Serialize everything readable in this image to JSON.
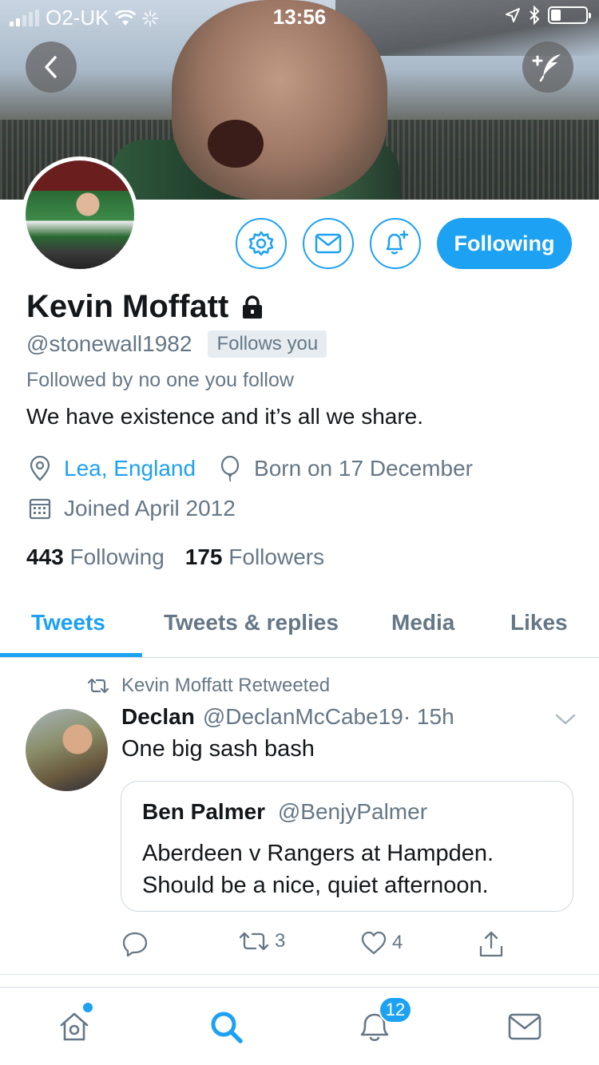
{
  "status_bar": {
    "carrier": "O2-UK",
    "time": "13:56"
  },
  "profile": {
    "name": "Kevin Moffatt",
    "handle": "@stonewall1982",
    "follows_you_label": "Follows you",
    "followed_by": "Followed by no one you follow",
    "bio": "We have existence and it’s all we share.",
    "location": "Lea, England",
    "birthday": "Born on 17 December",
    "joined": "Joined April 2012",
    "following_count": "443",
    "following_label": "Following",
    "followers_count": "175",
    "followers_label": "Followers",
    "follow_button_label": "Following",
    "locked": true
  },
  "tabs": [
    {
      "label": "Tweets",
      "active": true
    },
    {
      "label": "Tweets & replies",
      "active": false
    },
    {
      "label": "Media",
      "active": false
    },
    {
      "label": "Likes",
      "active": false
    }
  ],
  "tweet": {
    "retweeted_by": "Kevin Moffatt Retweeted",
    "author_name": "Declan",
    "author_handle": "@DeclanMcCabe19",
    "time": "· 15h",
    "text": "One big sash bash",
    "quote": {
      "author_name": "Ben Palmer",
      "author_handle": "@BenjyPalmer",
      "text": "Aberdeen v Rangers at Hampden. Should be a nice, quiet afternoon."
    },
    "retweet_count": "3",
    "like_count": "4"
  },
  "bottom_nav": {
    "notifications_badge": "12"
  },
  "colors": {
    "accent": "#1da1f2",
    "secondary_text": "#657786",
    "primary_text": "#14171a"
  }
}
